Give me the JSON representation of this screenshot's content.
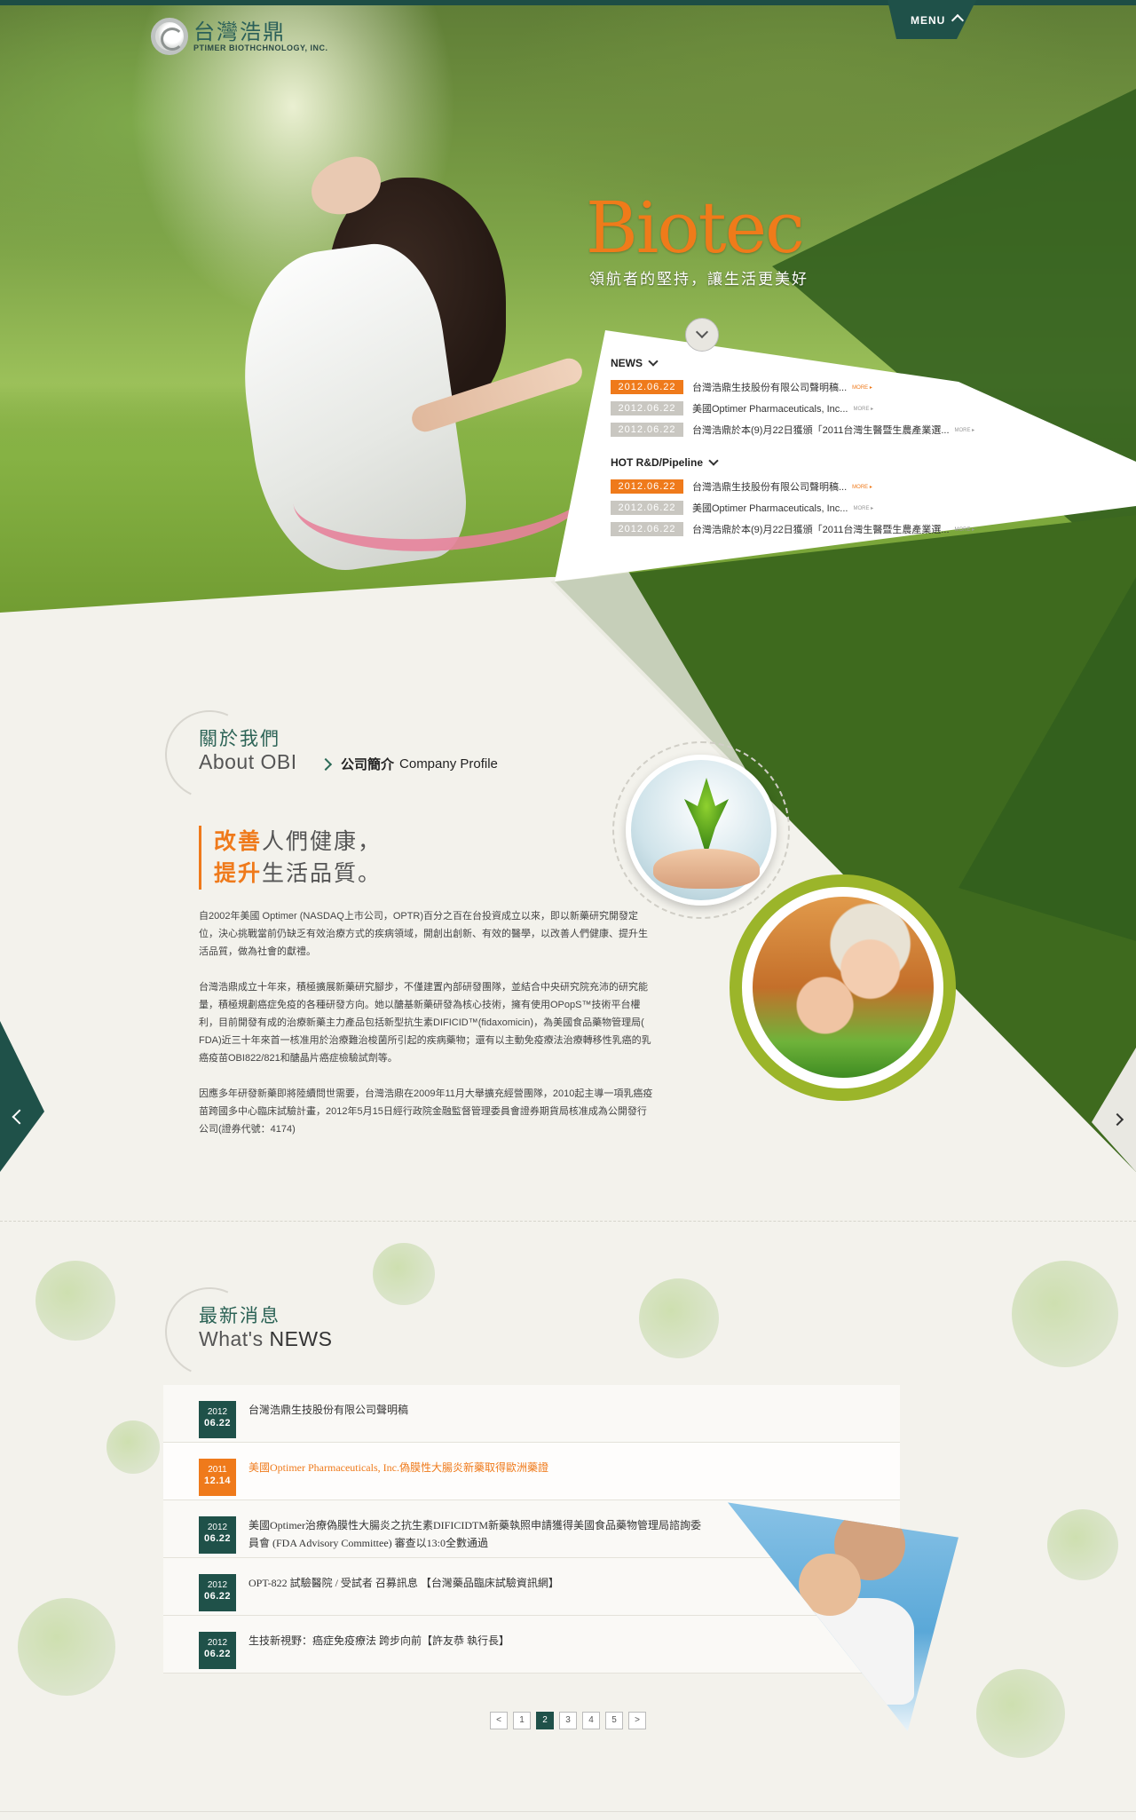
{
  "header": {
    "logo_cn": "台灣浩鼎",
    "logo_en": "PTIMER BIOTHCHNOLOGY, INC.",
    "menu_label": "MENU"
  },
  "hero": {
    "title": "Biotec",
    "tagline": "領航者的堅持，讓生活更美好"
  },
  "news_panel": {
    "news_label": "NEWS",
    "news_items": [
      {
        "date": "2012.06.22",
        "text": "台灣浩鼎生技股份有限公司聲明稿...",
        "more": "MORE ▸",
        "hot": true
      },
      {
        "date": "2012.06.22",
        "text": "美國Optimer Pharmaceuticals, Inc...",
        "more": "MORE ▸",
        "hot": false
      },
      {
        "date": "2012.06.22",
        "text": "台灣浩鼎於本(9)月22日獲頒「2011台灣生醫暨生農產業選...",
        "more": "MORE ▸",
        "hot": false
      }
    ],
    "rd_label": "HOT R&D/Pipeline",
    "rd_items": [
      {
        "date": "2012.06.22",
        "text": "台灣浩鼎生技股份有限公司聲明稿...",
        "more": "MORE ▸",
        "hot": true
      },
      {
        "date": "2012.06.22",
        "text": "美國Optimer Pharmaceuticals, Inc...",
        "more": "MORE ▸",
        "hot": false
      },
      {
        "date": "2012.06.22",
        "text": "台灣浩鼎於本(9)月22日獲頒「2011台灣生醫暨生農產業選...",
        "more": "MORE ▸",
        "hot": false
      }
    ]
  },
  "about": {
    "title_cn": "關於我們",
    "title_en": "About OBI",
    "crumb_cn": "公司簡介",
    "crumb_en": "Company Profile",
    "slogan_hl1": "改善",
    "slogan_rest1": "人們健康，",
    "slogan_hl2": "提升",
    "slogan_rest2": "生活品質。",
    "para1": "自2002年美國 Optimer (NASDAQ上市公司，OPTR)百分之百在台投資成立以來，即以新藥研究開發定位，決心挑戰當前仍缺乏有效治療方式的疾病領域，開創出創新、有效的醫學，以改善人們健康、提升生活品質，做為社會的獻禮。",
    "para2": "台灣浩鼎成立十年來，積極擴展新藥研究腳步，不僅建置內部研發團隊，並結合中央研究院充沛的研究能量，積極規劃癌症免疫的各種研發方向。她以醣基新藥研發為核心技術，擁有使用OPopS™技術平台權利，目前開發有成的治療新藥主力產品包括新型抗生素DIFICID™(fidaxomicin)，為美國食品藥物管理局( FDA)近三十年來首一核准用於治療難治梭菌所引起的疾病藥物；還有以主動免疫療法治療轉移性乳癌的乳癌疫苗OBI822/821和醣晶片癌症檢驗試劑等。",
    "para3": "因應多年研發新藥即將陸續問世需要，台灣浩鼎在2009年11月大舉擴充經營團隊，2010起主導一項乳癌疫苗跨國多中心臨床試驗計畫，2012年5月15日經行政院金融監督管理委員會證券期貨局核准成為公開發行公司(證券代號：4174)"
  },
  "latest": {
    "title_cn": "最新消息",
    "title_en_a": "What's",
    "title_en_b": "NEWS",
    "items": [
      {
        "year": "2012",
        "day": "06.22",
        "text": "台灣浩鼎生技股份有限公司聲明稿",
        "hot": false
      },
      {
        "year": "2011",
        "day": "12.14",
        "text": "美國Optimer Pharmaceuticals, Inc.偽膜性大腸炎新藥取得歐洲藥證",
        "hot": true
      },
      {
        "year": "2012",
        "day": "06.22",
        "text": "美國Optimer治療偽膜性大腸炎之抗生素DIFICIDTM新藥執照申請獲得美國食品藥物管理局諮詢委員會 (FDA Advisory Committee) 審查以13:0全數通過",
        "hot": false
      },
      {
        "year": "2012",
        "day": "06.22",
        "text": "OPT-822 試驗醫院 / 受試者 召募訊息 【台灣藥品臨床試驗資訊網】",
        "hot": false
      },
      {
        "year": "2012",
        "day": "06.22",
        "text": "生技新視野：癌症免疫療法 跨步向前【許友恭 執行長】",
        "hot": false
      }
    ],
    "pager": {
      "prev": "<",
      "pages": [
        "1",
        "2",
        "3",
        "4",
        "5"
      ],
      "current": "2",
      "next": ">"
    }
  },
  "colors": {
    "brand_green": "#1f5149",
    "accent_orange": "#ef7a1b",
    "olive": "#3e6a1e",
    "lime": "#9bb52a"
  }
}
